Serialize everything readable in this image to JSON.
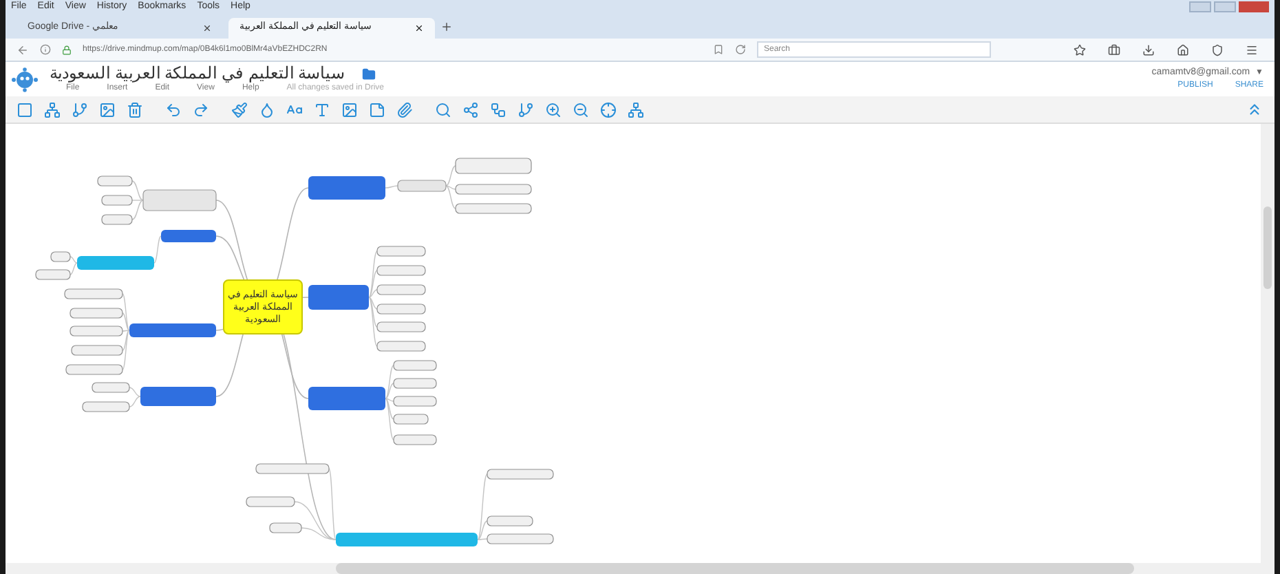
{
  "browser": {
    "menu": [
      "File",
      "Edit",
      "View",
      "History",
      "Bookmarks",
      "Tools",
      "Help"
    ],
    "tabs": [
      {
        "title": "معلمي - Google Drive",
        "selected": false
      },
      {
        "title": "سياسة التعليم في المملكة العربية",
        "selected": true
      }
    ],
    "url": "https://drive.mindmup.com/map/0B4k6l1mo0BlMr4aVbEZHDC2RN",
    "search": {
      "placeholder": "Search"
    }
  },
  "app": {
    "title": "سياسة التعليم في المملكة العربية السعودية",
    "menu": [
      "File",
      "Insert",
      "Edit",
      "View",
      "Help"
    ],
    "status": "All changes saved in Drive",
    "account": "camamtv8@gmail.com",
    "account_caret": "▼",
    "actions": [
      "PUBLISH",
      "SHARE"
    ]
  },
  "map": {
    "central": {
      "label": "سياسة التعليم في المملكة العربية السعودية"
    },
    "branches": [
      {
        "color": "#2f6fe0",
        "children": [
          {
            "color": "#e6e6e6",
            "children": [
              {
                "kind": "leaf"
              },
              {
                "kind": "leaf"
              },
              {
                "kind": "leaf"
              }
            ]
          }
        ]
      },
      {
        "color": "#2f6fe0",
        "children": [
          {
            "kind": "leaf"
          },
          {
            "kind": "leaf"
          },
          {
            "kind": "leaf"
          },
          {
            "kind": "leaf"
          },
          {
            "kind": "leaf"
          },
          {
            "kind": "leaf"
          }
        ]
      },
      {
        "color": "#2f6fe0",
        "children": [
          {
            "kind": "leaf"
          },
          {
            "kind": "leaf"
          },
          {
            "kind": "leaf"
          },
          {
            "kind": "leaf"
          },
          {
            "kind": "leaf"
          }
        ]
      },
      {
        "color": "#1fb8e6",
        "children": [
          {
            "kind": "leaf"
          },
          {
            "kind": "leaf"
          },
          {
            "kind": "leaf"
          },
          {
            "kind": "leaf"
          },
          {
            "kind": "leaf"
          },
          {
            "kind": "leaf"
          }
        ]
      },
      {
        "color": "#e6e6e6",
        "children": [
          {
            "kind": "leaf"
          },
          {
            "kind": "leaf"
          },
          {
            "kind": "leaf"
          }
        ]
      },
      {
        "color": "#2f6fe0",
        "children": [
          {
            "color": "#1fb8e6",
            "children": [
              {
                "kind": "leaf"
              },
              {
                "kind": "leaf"
              }
            ]
          }
        ]
      },
      {
        "color": "#2f6fe0",
        "children": [
          {
            "kind": "leaf"
          },
          {
            "kind": "leaf"
          },
          {
            "kind": "leaf"
          },
          {
            "kind": "leaf"
          },
          {
            "kind": "leaf"
          }
        ]
      },
      {
        "color": "#2f6fe0",
        "children": [
          {
            "kind": "leaf"
          },
          {
            "kind": "leaf"
          }
        ]
      }
    ]
  }
}
